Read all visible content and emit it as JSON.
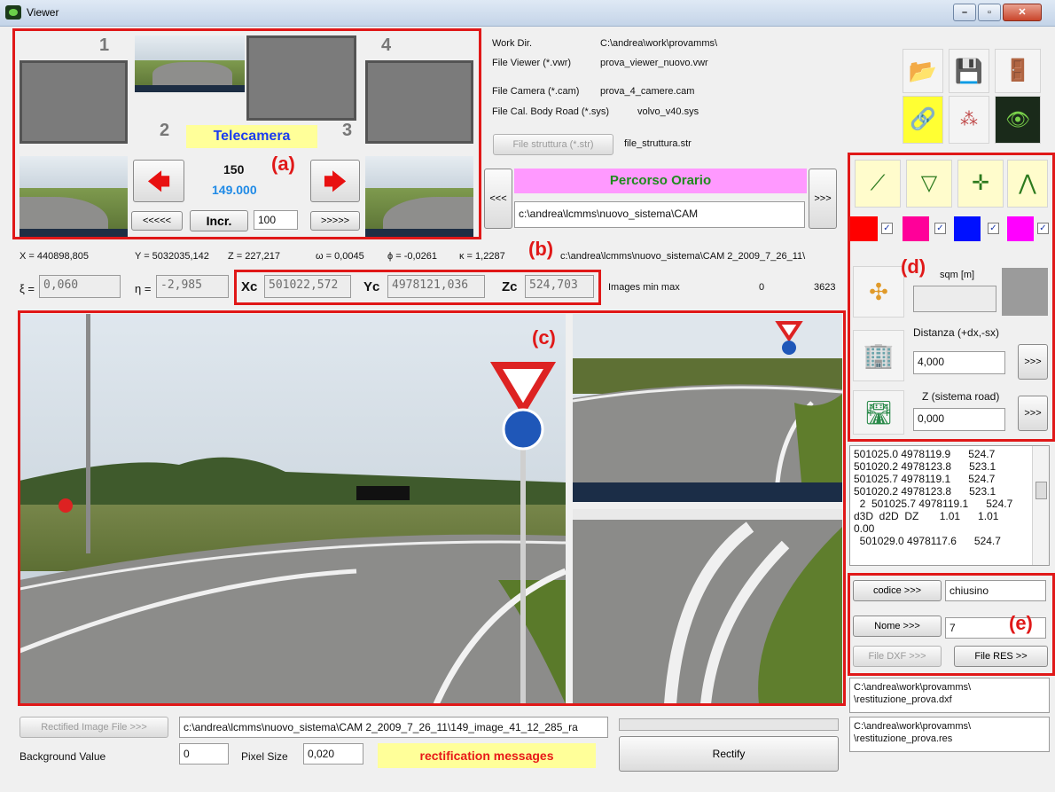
{
  "window": {
    "title": "Viewer"
  },
  "cameras": {
    "num1": "1",
    "num2": "2",
    "num3": "3",
    "num4": "4",
    "label": "Telecamera",
    "frame": "150",
    "position": "149.000",
    "prev_fast": "<<<<<",
    "next_fast": ">>>>>",
    "incr_label": "Incr.",
    "incr_value": "100",
    "annot": "(a)"
  },
  "files": {
    "work_dir_label": "Work Dir.",
    "work_dir_value": "C:\\andrea\\work\\provamms\\",
    "viewer_label": "File Viewer (*.vwr)",
    "viewer_value": "prova_viewer_nuovo.vwr",
    "camera_label": "File Camera (*.cam)",
    "camera_value": "prova_4_camere.cam",
    "calbody_label": "File Cal. Body Road  (*.sys)",
    "calbody_value": "volvo_v40.sys",
    "struttura_btn": "File struttura (*.str)",
    "struttura_value": "file_struttura.str"
  },
  "route": {
    "prev": "<<<",
    "next": ">>>",
    "title": "Percorso Orario",
    "path": "c:\\andrea\\lcmms\\nuovo_sistema\\CAM"
  },
  "coords": {
    "x": "X = 440898,805",
    "y": "Y = 5032035,142",
    "z": "Z = 227,217",
    "omega": "ω = 0,0045",
    "phi": "ϕ =  -0,0261",
    "kappa": "κ =  1,2287",
    "annot": "(b)",
    "img_path": "c:\\andrea\\lcmms\\nuovo_sistema\\CAM 2_2009_7_26_11\\",
    "xi_label": "ξ =",
    "xi_value": "0,060",
    "eta_label": "η =",
    "eta_value": "-2,985",
    "xc_label": "Xc",
    "xc_value": "501022,572",
    "yc_label": "Yc",
    "yc_value": "4978121,036",
    "zc_label": "Zc",
    "zc_value": "524,703",
    "minmax_label": "Images min max",
    "min": "0",
    "max": "3623"
  },
  "views": {
    "annot": "(c)"
  },
  "tools": {
    "annot": "(d)",
    "sqm_label": "sqm [m]",
    "distanza_label": "Distanza (+dx,-sx)",
    "distanza_value": "4,000",
    "distanza_btn": ">>>",
    "z_label": "Z (sistema road)",
    "z_value": "0,000",
    "z_btn": ">>>",
    "colors": [
      "#ff0000",
      "#ff0099",
      "#0010ff",
      "#ff00ff"
    ]
  },
  "results": {
    "lines": [
      "501025.0 4978119.9      524.7",
      "501020.2 4978123.8      523.1",
      "501025.7 4978119.1      524.7",
      "501020.2 4978123.8      523.1",
      "  2  501025.7 4978119.1      524.7",
      "d3D  d2D  DZ       1.01      1.01",
      "0.00",
      "  501029.0 4978117.6      524.7"
    ]
  },
  "codes": {
    "codice_btn": "codice >>>",
    "codice_value": "chiusino",
    "nome_btn": "Nome >>>",
    "nome_value": "7",
    "dxf_btn": "File DXF >>>",
    "res_btn": "File RES >>",
    "annot": "(e)",
    "dxf_path_1": "C:\\andrea\\work\\provamms\\",
    "dxf_path_2": "\\restituzione_prova.dxf",
    "res_path_1": "C:\\andrea\\work\\provamms\\",
    "res_path_2": "\\restituzione_prova.res"
  },
  "rectify": {
    "file_btn": "Rectified Image File >>>",
    "file_value": "c:\\andrea\\lcmms\\nuovo_sistema\\CAM 2_2009_7_26_11\\149_image_41_12_285_ra",
    "bg_label": "Background Value",
    "bg_value": "0",
    "pixel_label": "Pixel Size",
    "pixel_value": "0,020",
    "messages": "rectification messages",
    "rectify_btn": "Rectify"
  }
}
